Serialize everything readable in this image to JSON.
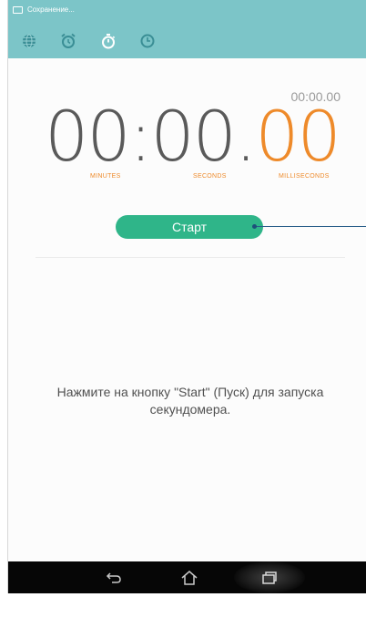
{
  "status_bar": {
    "icon": "screenshot-icon",
    "text": "Сохранение..."
  },
  "tabs": [
    {
      "name": "world-clock",
      "icon": "globe-icon",
      "active": false
    },
    {
      "name": "alarm",
      "icon": "alarm-clock-icon",
      "active": false
    },
    {
      "name": "stopwatch",
      "icon": "stopwatch-icon",
      "active": true
    },
    {
      "name": "timer",
      "icon": "timer-icon",
      "active": false
    }
  ],
  "stopwatch": {
    "lap_time": "00:00.00",
    "main_time": "00:00.",
    "milliseconds": "00",
    "units": {
      "minutes": "MINUTES",
      "seconds": "SECONDS",
      "milliseconds": "MILLISECONDS"
    }
  },
  "start_button": {
    "label": "Старт"
  },
  "hint": "Нажмите на кнопку \"Start\" (Пуск) для запуска секундомера.",
  "nav_bar": [
    {
      "name": "back",
      "icon": "back-icon"
    },
    {
      "name": "home",
      "icon": "home-icon"
    },
    {
      "name": "recent-apps",
      "icon": "recent-apps-icon"
    }
  ],
  "colors": {
    "header": "#7cc5c8",
    "accent_orange": "#ee8a2a",
    "button_green": "#2fb589",
    "nav_background": "#060606",
    "callout_line": "#2a5f8a"
  }
}
